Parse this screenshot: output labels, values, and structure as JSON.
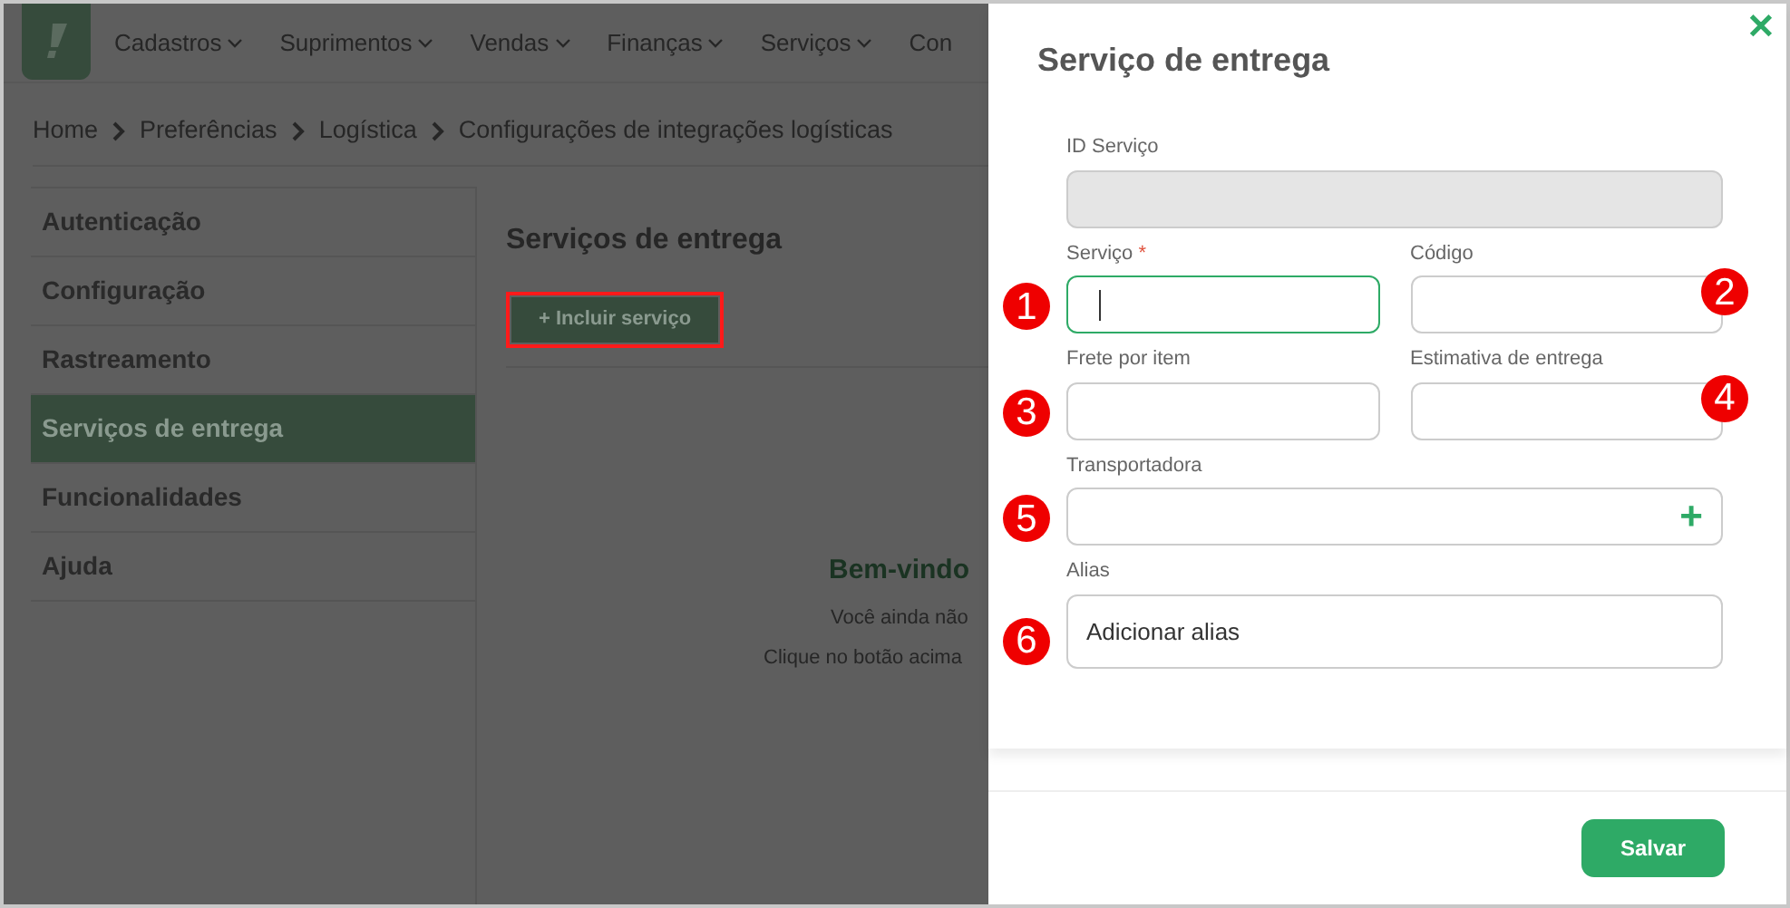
{
  "topbar": {
    "menu": [
      {
        "label": "Cadastros",
        "dropdown": true
      },
      {
        "label": "Suprimentos",
        "dropdown": true
      },
      {
        "label": "Vendas",
        "dropdown": true
      },
      {
        "label": "Finanças",
        "dropdown": true
      },
      {
        "label": "Serviços",
        "dropdown": true
      },
      {
        "label": "Con",
        "dropdown": false
      }
    ]
  },
  "breadcrumb": [
    "Home",
    "Preferências",
    "Logística",
    "Configurações de integrações logísticas"
  ],
  "sidebar": {
    "items": [
      {
        "label": "Autenticação",
        "selected": false
      },
      {
        "label": "Configuração",
        "selected": false
      },
      {
        "label": "Rastreamento",
        "selected": false
      },
      {
        "label": "Serviços de entrega",
        "selected": true
      },
      {
        "label": "Funcionalidades",
        "selected": false
      },
      {
        "label": "Ajuda",
        "selected": false
      }
    ]
  },
  "content": {
    "title": "Serviços de entrega",
    "add_button": {
      "label": "+ Incluir serviço",
      "highlighted": true
    },
    "empty_state": {
      "title": "Bem-vindo",
      "lines": [
        "Você ainda não",
        "Clique no botão acima"
      ]
    }
  },
  "panel": {
    "title": "Serviço de entrega",
    "close": "✕",
    "rows": [
      [
        {
          "label": "ID Serviço",
          "disabled": true,
          "focused": false
        }
      ],
      [
        {
          "label": "Serviço",
          "required_mark": "*",
          "disabled": false,
          "focused": true,
          "annotation": "1"
        },
        {
          "label": "Código",
          "disabled": false,
          "focused": false,
          "annotation": "2"
        }
      ],
      [
        {
          "label": "Frete por item",
          "disabled": false,
          "focused": false,
          "annotation": "3"
        },
        {
          "label": "Estimativa de entrega",
          "disabled": false,
          "focused": false,
          "annotation": "4"
        }
      ],
      [
        {
          "label": "Transportadora",
          "disabled": false,
          "focused": false,
          "annotation": "5",
          "add_icon": "+"
        }
      ],
      [
        {
          "label": "Alias",
          "disabled": false,
          "focused": false,
          "annotation": "6",
          "placeholder": "Adicionar alias"
        }
      ]
    ],
    "save_button": "Salvar"
  }
}
